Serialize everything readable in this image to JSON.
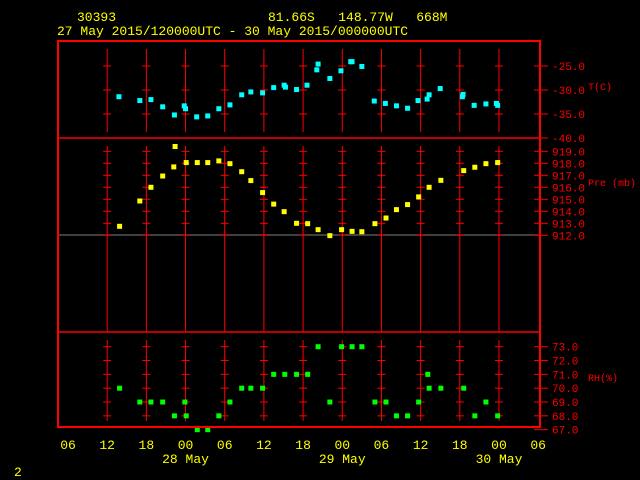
{
  "header": {
    "station_id": "30393",
    "location": "81.66S   148.77W   668M",
    "time_range": "27 May 2015/120000UTC - 30 May 2015/000000UTC"
  },
  "footer": {
    "page_number": "2"
  },
  "colors": {
    "frame": "#ff0000",
    "text": "#ffff00",
    "temperature": "#00ffff",
    "pressure": "#ffff00",
    "rh": "#00ff00",
    "grid_gray": "#808080"
  },
  "chart_data": [
    {
      "type": "scatter",
      "name": "temperature",
      "ylabel": "T(C)",
      "ylim": [
        -40,
        -22
      ],
      "yticks": [
        "-25.0",
        "-30.0",
        "-35.0",
        "-40.0"
      ],
      "ytick_values": [
        -25,
        -30,
        -35,
        -40
      ],
      "x_units": "hours since 27 May 00 UTC",
      "points": [
        [
          13.8,
          -31.4
        ],
        [
          17.0,
          -32.2
        ],
        [
          18.7,
          -32.0
        ],
        [
          20.5,
          -33.5
        ],
        [
          22.3,
          -35.2
        ],
        [
          23.8,
          -33.3
        ],
        [
          24.0,
          -33.9
        ],
        [
          25.7,
          -35.6
        ],
        [
          27.4,
          -35.4
        ],
        [
          29.1,
          -33.9
        ],
        [
          30.8,
          -33.1
        ],
        [
          32.6,
          -31.0
        ],
        [
          34.0,
          -30.4
        ],
        [
          35.8,
          -30.6
        ],
        [
          37.5,
          -29.5
        ],
        [
          39.1,
          -29.0
        ],
        [
          39.3,
          -29.4
        ],
        [
          41.0,
          -29.9
        ],
        [
          42.6,
          -29.0
        ],
        [
          44.1,
          -25.8
        ],
        [
          44.3,
          -24.6
        ],
        [
          46.1,
          -27.6
        ],
        [
          47.8,
          -26.0
        ],
        [
          49.3,
          -24.1
        ],
        [
          49.5,
          -24.1
        ],
        [
          51.0,
          -25.1
        ],
        [
          52.9,
          -32.3
        ],
        [
          54.6,
          -32.8
        ],
        [
          56.3,
          -33.3
        ],
        [
          58.0,
          -33.8
        ],
        [
          59.6,
          -32.2
        ],
        [
          61.0,
          -31.9
        ],
        [
          61.3,
          -31.0
        ],
        [
          63.0,
          -29.7
        ],
        [
          66.5,
          -30.9
        ],
        [
          66.4,
          -31.4
        ],
        [
          68.2,
          -33.2
        ],
        [
          70.0,
          -32.9
        ],
        [
          71.6,
          -32.8
        ],
        [
          71.8,
          -33.2
        ]
      ]
    },
    {
      "type": "scatter",
      "name": "pressure",
      "ylabel": "Pre (mb)",
      "ylim": [
        912,
        919
      ],
      "yticks": [
        "919.0",
        "918.0",
        "917.0",
        "916.0",
        "915.0",
        "914.0",
        "913.0",
        "912.0"
      ],
      "ytick_values": [
        919,
        918,
        917,
        916,
        915,
        914,
        913,
        912
      ],
      "x_units": "hours since 27 May 00 UTC",
      "points": [
        [
          13.9,
          912.75
        ],
        [
          17.0,
          914.86
        ],
        [
          18.7,
          916.0
        ],
        [
          20.5,
          916.94
        ],
        [
          22.2,
          917.7
        ],
        [
          22.4,
          919.4
        ],
        [
          24.1,
          918.06
        ],
        [
          25.8,
          918.06
        ],
        [
          27.4,
          918.06
        ],
        [
          29.1,
          918.2
        ],
        [
          30.8,
          917.97
        ],
        [
          32.6,
          917.3
        ],
        [
          34.0,
          916.56
        ],
        [
          35.8,
          915.56
        ],
        [
          37.5,
          914.6
        ],
        [
          39.1,
          913.97
        ],
        [
          41.0,
          913.0
        ],
        [
          42.7,
          912.97
        ],
        [
          44.3,
          912.47
        ],
        [
          46.1,
          911.97
        ],
        [
          47.9,
          912.47
        ],
        [
          49.5,
          912.33
        ],
        [
          51.0,
          912.3
        ],
        [
          53.0,
          912.97
        ],
        [
          54.7,
          913.44
        ],
        [
          56.3,
          914.14
        ],
        [
          58.0,
          914.56
        ],
        [
          59.7,
          915.2
        ],
        [
          61.3,
          916.0
        ],
        [
          63.1,
          916.58
        ],
        [
          66.6,
          917.39
        ],
        [
          68.3,
          917.67
        ],
        [
          70.0,
          917.97
        ],
        [
          71.8,
          918.06
        ]
      ]
    },
    {
      "type": "scatter",
      "name": "relative-humidity",
      "ylabel": "RH(%)",
      "ylim": [
        67,
        73
      ],
      "yticks": [
        "73.0",
        "72.0",
        "71.0",
        "70.0",
        "69.0",
        "68.0",
        "67.0"
      ],
      "ytick_values": [
        73,
        72,
        71,
        70,
        69,
        68,
        67
      ],
      "x_units": "hours since 27 May 00 UTC",
      "points": [
        [
          13.9,
          70
        ],
        [
          17.0,
          69
        ],
        [
          18.7,
          69
        ],
        [
          20.5,
          69
        ],
        [
          22.3,
          68
        ],
        [
          23.9,
          69
        ],
        [
          24.1,
          68
        ],
        [
          25.8,
          67
        ],
        [
          27.4,
          67
        ],
        [
          29.1,
          68
        ],
        [
          30.8,
          69
        ],
        [
          32.6,
          70
        ],
        [
          34.0,
          70
        ],
        [
          35.8,
          70
        ],
        [
          37.5,
          71
        ],
        [
          39.2,
          71
        ],
        [
          41.0,
          71
        ],
        [
          42.7,
          71
        ],
        [
          44.3,
          73
        ],
        [
          46.1,
          69
        ],
        [
          47.9,
          73
        ],
        [
          49.5,
          73
        ],
        [
          51.0,
          73
        ],
        [
          53.0,
          69
        ],
        [
          54.7,
          69
        ],
        [
          56.3,
          68
        ],
        [
          58.0,
          68
        ],
        [
          59.7,
          69
        ],
        [
          61.1,
          71
        ],
        [
          61.3,
          70
        ],
        [
          63.1,
          70
        ],
        [
          66.6,
          70
        ],
        [
          68.3,
          68
        ],
        [
          70.0,
          69
        ],
        [
          71.8,
          68
        ]
      ]
    }
  ],
  "xaxis": {
    "xlim": [
      6,
      78
    ],
    "tick_hours": [
      6,
      12,
      18,
      24,
      30,
      36,
      42,
      48,
      54,
      60,
      66,
      72,
      78
    ],
    "tick_labels": [
      "06",
      "12",
      "18",
      "00",
      "06",
      "12",
      "18",
      "00",
      "06",
      "12",
      "18",
      "00",
      "06"
    ],
    "date_labels": [
      {
        "hour": 24,
        "label": "28 May"
      },
      {
        "hour": 48,
        "label": "29 May"
      },
      {
        "hour": 72,
        "label": "30 May"
      }
    ]
  }
}
